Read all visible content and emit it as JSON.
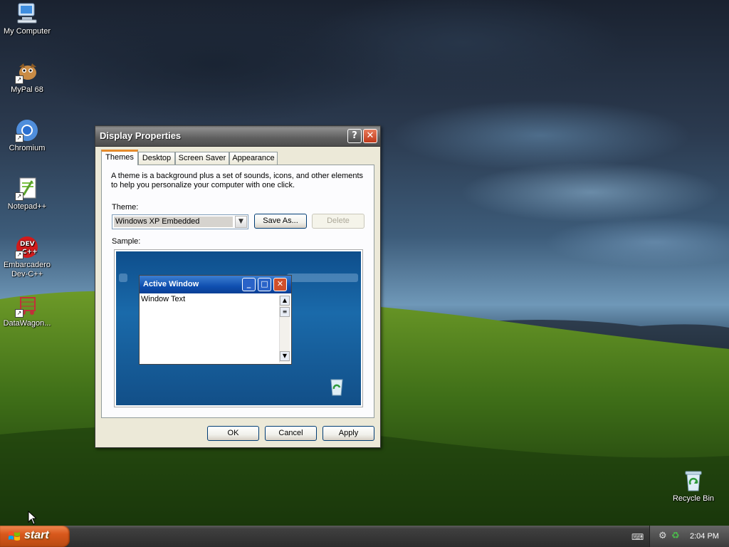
{
  "desktop": {
    "icons": [
      {
        "label": "My Computer"
      },
      {
        "label": "MyPal 68"
      },
      {
        "label": "Chromium"
      },
      {
        "label": "Notepad++"
      },
      {
        "label_line1": "Embarcadero",
        "label_line2": "Dev-C++"
      },
      {
        "label": "DataWagon..."
      }
    ],
    "recycle_bin": {
      "label": "Recycle Bin"
    }
  },
  "dialog": {
    "title": "Display Properties",
    "help_button": "?",
    "close_button": "✕",
    "tabs": [
      {
        "label": "Themes",
        "active": true
      },
      {
        "label": "Desktop"
      },
      {
        "label": "Screen Saver"
      },
      {
        "label": "Appearance"
      }
    ],
    "description": "A theme is a background plus a set of sounds, icons, and other elements to help you personalize your computer with one click.",
    "theme_label": "Theme:",
    "theme_value": "Windows XP Embedded",
    "save_as_label": "Save As...",
    "delete_label": "Delete",
    "sample_label": "Sample:",
    "sample": {
      "window_title": "Active Window",
      "window_text": "Window Text"
    },
    "ok_label": "OK",
    "cancel_label": "Cancel",
    "apply_label": "Apply"
  },
  "taskbar": {
    "start_label": "start",
    "clock": "2:04 PM"
  },
  "colors": {
    "taskbar": "#3a3a3a",
    "start_button": "#d8581c",
    "dialog_face": "#ece9d8",
    "active_tab_accent": "#e68b2c"
  }
}
